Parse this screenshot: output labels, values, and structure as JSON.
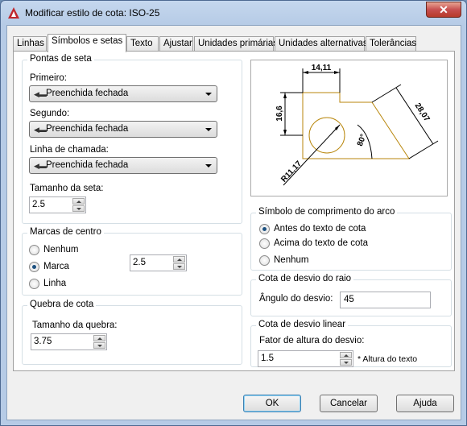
{
  "window": {
    "title": "Modificar estilo de cota: ISO-25",
    "close_glyph": "✕",
    "accent": "#c75050"
  },
  "tabs": [
    {
      "label": "Linhas"
    },
    {
      "label": "Símbolos e setas"
    },
    {
      "label": "Texto"
    },
    {
      "label": "Ajustar"
    },
    {
      "label": "Unidades primárias"
    },
    {
      "label": "Unidades alternativas"
    },
    {
      "label": "Tolerâncias"
    }
  ],
  "arrowheads": {
    "title": "Pontas de seta",
    "first_label": "Primeiro:",
    "first_value": "Preenchida fechada",
    "second_label": "Segundo:",
    "second_value": "Preenchida fechada",
    "leader_label": "Linha de chamada:",
    "leader_value": "Preenchida fechada",
    "size_label": "Tamanho da seta:",
    "size_value": "2.5"
  },
  "center_marks": {
    "title": "Marcas de centro",
    "options": [
      "Nenhum",
      "Marca",
      "Linha"
    ],
    "selected": "Marca",
    "size_value": "2.5"
  },
  "dim_break": {
    "title": "Quebra de cota",
    "size_label": "Tamanho da quebra:",
    "size_value": "3.75"
  },
  "preview": {
    "dim_top": "14,11",
    "dim_left": "16,6",
    "dim_right": "28,07",
    "dim_angle": "80°",
    "dim_radius": "R11,17",
    "shape_color": "#b8860b"
  },
  "arc_length": {
    "title": "Símbolo de comprimento do arco",
    "options": [
      "Antes do texto de cota",
      "Acima do texto de cota",
      "Nenhum"
    ],
    "selected": "Antes do texto de cota"
  },
  "radius_jog": {
    "title": "Cota de desvio do raio",
    "angle_label": "Ângulo do desvio:",
    "angle_value": "45"
  },
  "linear_jog": {
    "title": "Cota de desvio linear",
    "height_label": "Fator de altura do desvio:",
    "height_value": "1.5",
    "height_suffix": "* Altura do texto"
  },
  "buttons": {
    "ok": "OK",
    "cancel": "Cancelar",
    "help": "Ajuda"
  }
}
